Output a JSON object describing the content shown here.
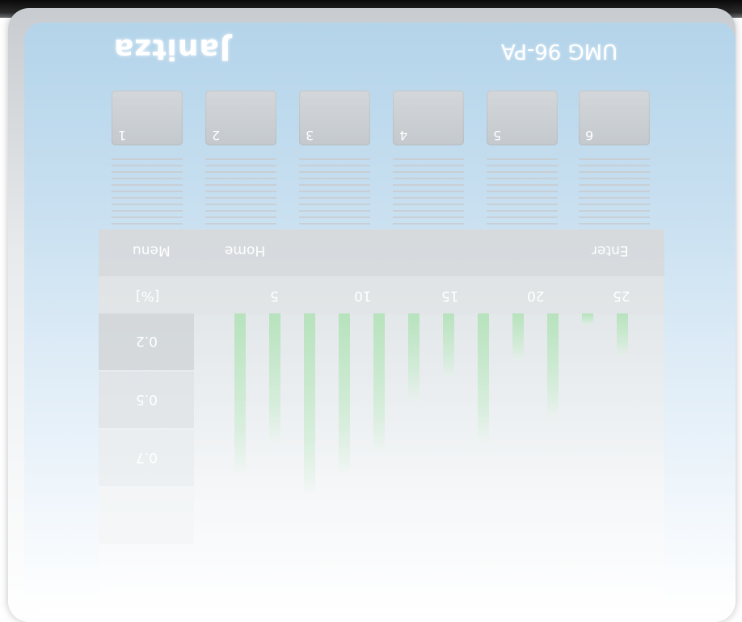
{
  "brand": "Janitza",
  "model": "UMG 96-PA",
  "channels": [
    "1",
    "2",
    "3",
    "4",
    "5",
    "6"
  ],
  "display": {
    "header": {
      "menu": "Menu",
      "home": "Home",
      "enter": "Enter"
    },
    "scale": [
      "[%]",
      "5",
      "10",
      "15",
      "20",
      "25"
    ],
    "row_labels": [
      "0.2",
      "0.5",
      "0.7",
      ""
    ],
    "bar_color": "#b2e2b8",
    "bar_levels": [
      0.55,
      0.45,
      0.62,
      0.55,
      0.48,
      0.3,
      0.22,
      0.45,
      0.16,
      0.36,
      0.04,
      0.15
    ]
  },
  "colors": {
    "panel_blue": "#b4d4ea",
    "key_gray": "#c8ccd0"
  }
}
